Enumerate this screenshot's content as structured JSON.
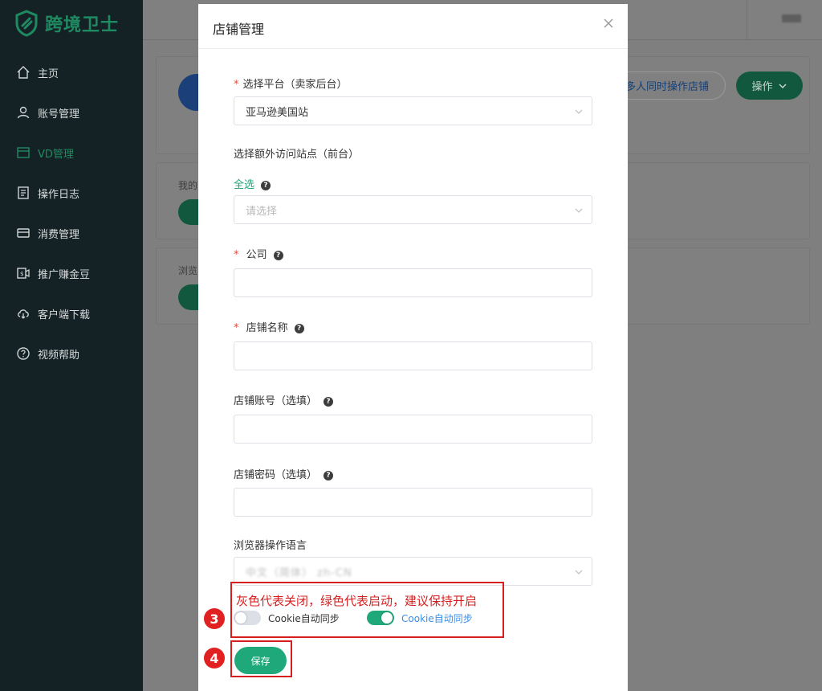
{
  "app": {
    "brand": "跨境卫士",
    "user_name": ""
  },
  "sidebar": {
    "items": [
      {
        "label": "主页",
        "icon": "home-icon"
      },
      {
        "label": "账号管理",
        "icon": "user-icon"
      },
      {
        "label": "VD管理",
        "icon": "window-icon",
        "active": true
      },
      {
        "label": "操作日志",
        "icon": "log-icon"
      },
      {
        "label": "消费管理",
        "icon": "card-icon"
      },
      {
        "label": "推广赚金豆",
        "icon": "megaphone-icon"
      },
      {
        "label": "客户端下载",
        "icon": "cloud-download-icon"
      },
      {
        "label": "视频帮助",
        "icon": "question-icon"
      }
    ]
  },
  "background": {
    "multi_user_button": "多人同时操作店铺",
    "operate_button": "操作",
    "text_1": "我的",
    "text_2": "浏览"
  },
  "modal": {
    "title": "店铺管理",
    "platform": {
      "label": "选择平台（卖家后台）",
      "value": "亚马逊美国站"
    },
    "extra_sites": {
      "label": "选择额外访问站点（前台）",
      "select_all": "全选",
      "placeholder": "请选择"
    },
    "company": {
      "label": "公司",
      "value": ""
    },
    "shop_name": {
      "label": "店铺名称",
      "value": ""
    },
    "shop_account": {
      "label": "店铺账号（选填）",
      "value": ""
    },
    "shop_password": {
      "label": "店铺密码（选填）",
      "value": ""
    },
    "browser_lang": {
      "label": "浏览器操作语言",
      "value": "中文（简体） zh-CN"
    },
    "annotation": "灰色代表关闭，绿色代表启动，建议保持开启",
    "cookie_off_label": "Cookie自动同步",
    "cookie_on_label": "Cookie自动同步",
    "save_label": "保存",
    "step_3": "3",
    "step_4": "4"
  },
  "colors": {
    "accent": "#1fa97a",
    "annotation": "#d71e1e",
    "sidebar_bg": "#152225"
  }
}
